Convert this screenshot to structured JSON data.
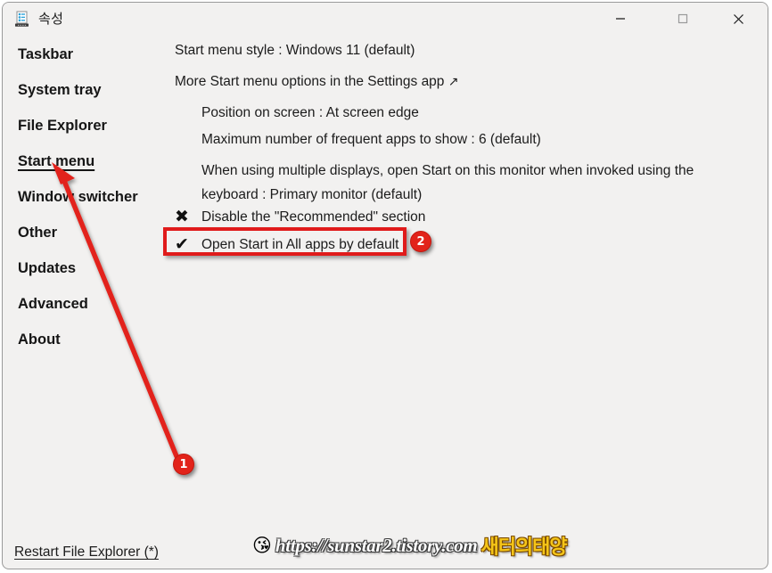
{
  "window": {
    "title": "속성",
    "app_icon": "taskbar-properties-icon",
    "controls": {
      "minimize": "minimize-icon",
      "maximize": "maximize-icon",
      "close": "close-icon"
    }
  },
  "sidebar": {
    "items": [
      {
        "label": "Taskbar",
        "selected": false
      },
      {
        "label": "System tray",
        "selected": false
      },
      {
        "label": "File Explorer",
        "selected": false
      },
      {
        "label": "Start menu",
        "selected": true
      },
      {
        "label": "Window switcher",
        "selected": false
      },
      {
        "label": "Other",
        "selected": false
      },
      {
        "label": "Updates",
        "selected": false
      },
      {
        "label": "Advanced",
        "selected": false
      },
      {
        "label": "About",
        "selected": false
      }
    ]
  },
  "content": {
    "style_setting": "Start menu style : Windows 11 (default)",
    "settings_app_link": "More Start menu options in the Settings app",
    "settings_app_link_icon": "↗",
    "position_setting": "Position on screen : At screen edge",
    "frequent_apps_setting": "Maximum number of frequent apps to show : 6 (default)",
    "multi_display_setting": "When using multiple displays, open Start on this monitor when invoked using the keyboard : Primary monitor (default)",
    "checkboxes": [
      {
        "glyph": "✖",
        "state": "unchecked",
        "label": "Disable the \"Recommended\" section"
      },
      {
        "glyph": "✔",
        "state": "checked",
        "label": "Open Start in All apps by default"
      }
    ]
  },
  "footer": {
    "restart_link": "Restart File Explorer (*)"
  },
  "annotations": {
    "badges": [
      {
        "number": "1",
        "color": "#e2231a"
      },
      {
        "number": "2",
        "color": "#e2231a"
      }
    ],
    "highlight_color": "#e01b1b",
    "arrow_color": "#e2231a"
  },
  "watermark": {
    "emoji": "😘",
    "url": "https://sunstar2.tistory.com",
    "korean": "새터의태양"
  }
}
